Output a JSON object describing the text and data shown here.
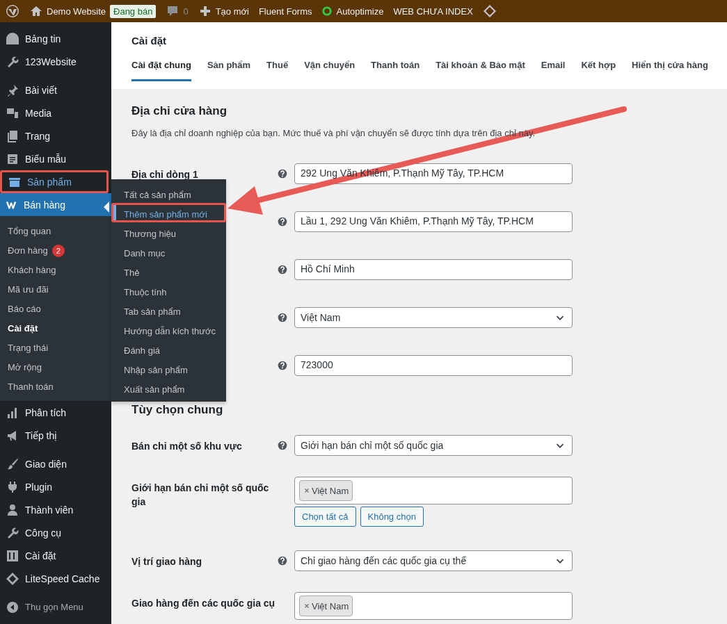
{
  "admin_bar": {
    "items": [
      {
        "kind": "logo"
      },
      {
        "kind": "site",
        "label": "Demo Website"
      },
      {
        "kind": "badge",
        "label": "Đang bán"
      },
      {
        "kind": "comments",
        "label": "0"
      },
      {
        "kind": "new",
        "label": "Tạo mới"
      },
      {
        "kind": "text",
        "label": "Fluent Forms"
      },
      {
        "kind": "status",
        "label": "Autoptimize"
      },
      {
        "kind": "text",
        "label": "WEB CHƯA INDEX"
      },
      {
        "kind": "diamond"
      }
    ]
  },
  "sidebar": {
    "groups": [
      [
        {
          "label": "Bảng tin",
          "selected": false,
          "highlighted": false
        },
        {
          "label": "123Website",
          "selected": false,
          "highlighted": false
        }
      ],
      [
        {
          "label": "Bài viết",
          "selected": false,
          "highlighted": false
        },
        {
          "label": "Media",
          "selected": false,
          "highlighted": false
        },
        {
          "label": "Trang",
          "selected": false,
          "highlighted": false
        },
        {
          "label": "Biểu mẫu",
          "selected": false,
          "highlighted": false
        },
        {
          "label": "Sản phẩm",
          "selected": false,
          "highlighted": true
        },
        {
          "label": "Bán hàng",
          "selected": true,
          "highlighted": false,
          "children": [
            {
              "label": "Tổng quan",
              "selected": false
            },
            {
              "label": "Đơn hàng",
              "selected": false,
              "badge": "2"
            },
            {
              "label": "Khách hàng",
              "selected": false
            },
            {
              "label": "Mã ưu đãi",
              "selected": false
            },
            {
              "label": "Báo cáo",
              "selected": false
            },
            {
              "label": "Cài đặt",
              "selected": true
            },
            {
              "label": "Trạng thái",
              "selected": false
            },
            {
              "label": "Mở rộng",
              "selected": false
            },
            {
              "label": "Thanh toán",
              "selected": false
            }
          ]
        },
        {
          "label": "Phân tích",
          "selected": false,
          "highlighted": false
        },
        {
          "label": "Tiếp thị",
          "selected": false,
          "highlighted": false
        }
      ],
      [
        {
          "label": "Giao diện",
          "selected": false,
          "highlighted": false
        },
        {
          "label": "Plugin",
          "selected": false,
          "highlighted": false
        },
        {
          "label": "Thành viên",
          "selected": false,
          "highlighted": false
        },
        {
          "label": "Công cụ",
          "selected": false,
          "highlighted": false
        },
        {
          "label": "Cài đặt",
          "selected": false,
          "highlighted": false
        },
        {
          "label": "LiteSpeed Cache",
          "selected": false,
          "highlighted": false
        }
      ],
      [
        {
          "label": "Thu gọn Menu",
          "selected": false,
          "highlighted": false
        }
      ]
    ]
  },
  "flyout_menu": {
    "items": [
      {
        "label": "Tất cả sản phẩm",
        "selected": false,
        "highlighted": false
      },
      {
        "label": "Thêm sản phẩm mới",
        "selected": true,
        "highlighted": true
      },
      {
        "label": "Thương hiệu",
        "selected": false,
        "highlighted": false
      },
      {
        "label": "Danh mục",
        "selected": false,
        "highlighted": false
      },
      {
        "label": "Thẻ",
        "selected": false,
        "highlighted": false
      },
      {
        "label": "Thuộc tính",
        "selected": false,
        "highlighted": false
      },
      {
        "label": "Tab sản phẩm",
        "selected": false,
        "highlighted": false
      },
      {
        "label": "Hướng dẫn kích thước",
        "selected": false,
        "highlighted": false
      },
      {
        "label": "Đánh giá",
        "selected": false,
        "highlighted": false
      },
      {
        "label": "Nhập sản phẩm",
        "selected": false,
        "highlighted": false
      },
      {
        "label": "Xuất sản phẩm",
        "selected": false,
        "highlighted": false
      }
    ]
  },
  "page": {
    "title": "Cài đặt",
    "tabs": [
      {
        "label": "Cài đặt chung",
        "selected": true
      },
      {
        "label": "Sản phẩm",
        "selected": false
      },
      {
        "label": "Thuế",
        "selected": false
      },
      {
        "label": "Vận chuyển",
        "selected": false
      },
      {
        "label": "Thanh toán",
        "selected": false
      },
      {
        "label": "Tài khoản & Bảo mật",
        "selected": false
      },
      {
        "label": "Email",
        "selected": false
      },
      {
        "label": "Kết hợp",
        "selected": false
      },
      {
        "label": "Hiển thị cửa hàng",
        "selected": false
      }
    ],
    "sections": [
      {
        "heading": "Địa chỉ cửa hàng",
        "description": "Đây là địa chỉ doanh nghiệp của bạn. Mức thuế và phí vận chuyển sẽ được tính dựa trên địa chỉ này.",
        "fields": [
          {
            "kind": "text",
            "label": "Địa chỉ dòng 1",
            "value": "292 Ung Văn Khiêm, P.Thạnh Mỹ Tây, TP.HCM"
          },
          {
            "kind": "text",
            "value": "Lầu 1, 292 Ung Văn Khiêm, P.Thạnh Mỹ Tây, TP.HCM"
          },
          {
            "kind": "text",
            "value": "Hồ Chí Minh"
          },
          {
            "kind": "select",
            "value": "Việt Nam"
          },
          {
            "kind": "text",
            "value": "723000"
          }
        ]
      },
      {
        "heading": "Tùy chọn chung",
        "fields": [
          {
            "kind": "select",
            "label": "Bán chỉ một số khu vực",
            "value": "Giới hạn bán chỉ một số quốc gia"
          },
          {
            "kind": "multiselect",
            "label": "Giới hạn bán chỉ một số quốc gia",
            "tags": [
              "Việt Nam"
            ],
            "buttons": [
              "Chọn tất cả",
              "Không chọn"
            ]
          },
          {
            "kind": "select",
            "label": "Vị trí giao hàng",
            "value": "Chỉ giao hàng đến các quốc gia cụ thể"
          },
          {
            "kind": "multiselect",
            "label": "Giao hàng đến các quốc gia cụ",
            "tags": [
              "Việt Nam"
            ]
          }
        ]
      }
    ]
  }
}
